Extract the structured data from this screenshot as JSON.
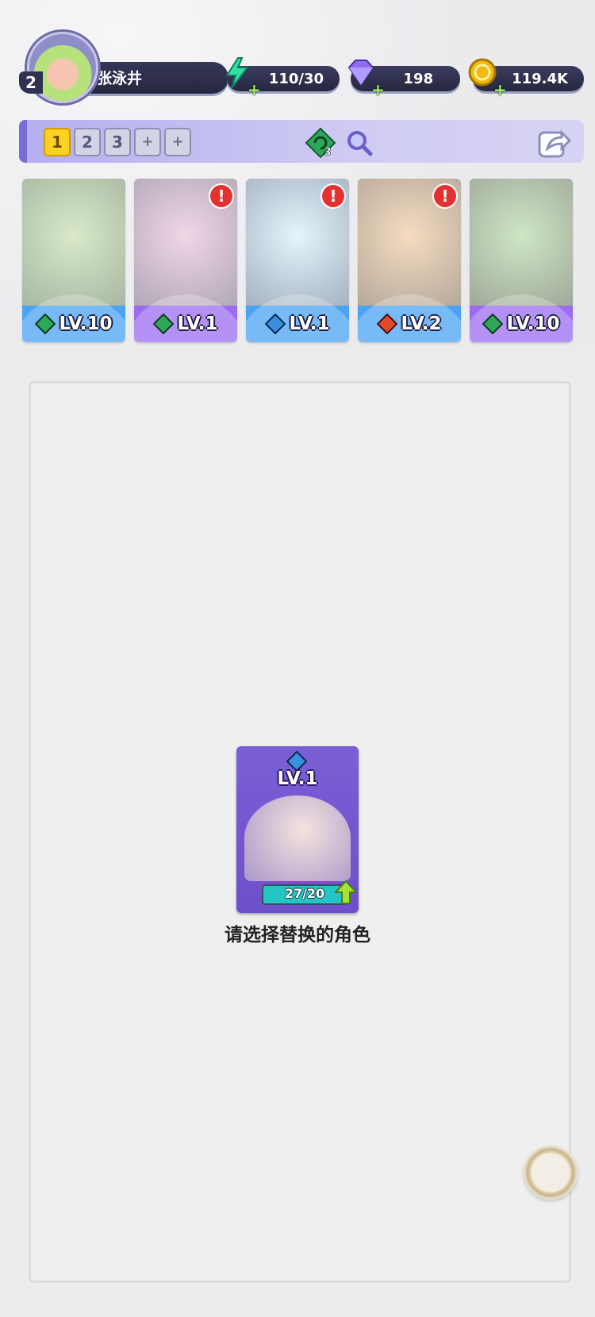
{
  "profile": {
    "level": "2",
    "name": "张泳井"
  },
  "resources": [
    {
      "id": "energy",
      "icon": "lightning-icon",
      "value": "110/30",
      "color": "#2fe0a0"
    },
    {
      "id": "gem",
      "icon": "diamond-icon",
      "value": "198",
      "color": "#8f6cf0"
    },
    {
      "id": "coin",
      "icon": "coin-icon",
      "value": "119.4K",
      "color": "#f2b90f"
    }
  ],
  "team_tabs": {
    "items": [
      "1",
      "2",
      "3",
      "+",
      "+"
    ],
    "selected": "1"
  },
  "element_gem": {
    "count": "3"
  },
  "heroes": [
    {
      "level": "LV.10",
      "element": "wind",
      "alert": "",
      "base_color": "#4aa3f5",
      "art_color": "#b5d7a6"
    },
    {
      "level": "LV.1",
      "element": "wind",
      "alert": "!",
      "base_color": "#9b6cf0",
      "art_color": "#d9a9c6"
    },
    {
      "level": "LV.1",
      "element": "water",
      "alert": "!",
      "base_color": "#4aa3f5",
      "art_color": "#bfe3f8"
    },
    {
      "level": "LV.2",
      "element": "fire",
      "alert": "!",
      "base_color": "#4aa3f5",
      "art_color": "#e8b582"
    },
    {
      "level": "LV.10",
      "element": "wind",
      "alert": "",
      "base_color": "#9b6cf0",
      "art_color": "#9ecf8b"
    }
  ],
  "hero_alert_symbol": "!",
  "selected_card": {
    "level": "LV.1",
    "progress": "27/20",
    "element": "water"
  },
  "prompt": "请选择替换的角色"
}
